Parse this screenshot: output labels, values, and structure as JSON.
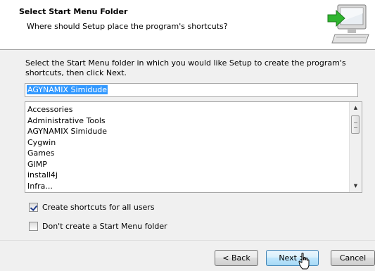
{
  "header": {
    "title": "Select Start Menu Folder",
    "subtitle": "Where should Setup place the program's shortcuts?",
    "icon": "computer-install-icon"
  },
  "main": {
    "instruction": "Select the Start Menu folder in which you would like Setup to create the program's shortcuts, then click Next.",
    "folder_input_value": "AGYNAMIX Simidude",
    "folder_list": [
      "Accessories",
      "Administrative Tools",
      "AGYNAMIX Simidude",
      "Cygwin",
      "Games",
      "GIMP",
      "install4j",
      "Infra..."
    ],
    "checkbox_all_users": {
      "label": "Create shortcuts for all users",
      "checked": true
    },
    "checkbox_no_folder": {
      "label": "Don't create a Start Menu folder",
      "checked": false
    }
  },
  "footer": {
    "back_label": "< Back",
    "next_label": "Next >",
    "cancel_label": "Cancel"
  }
}
